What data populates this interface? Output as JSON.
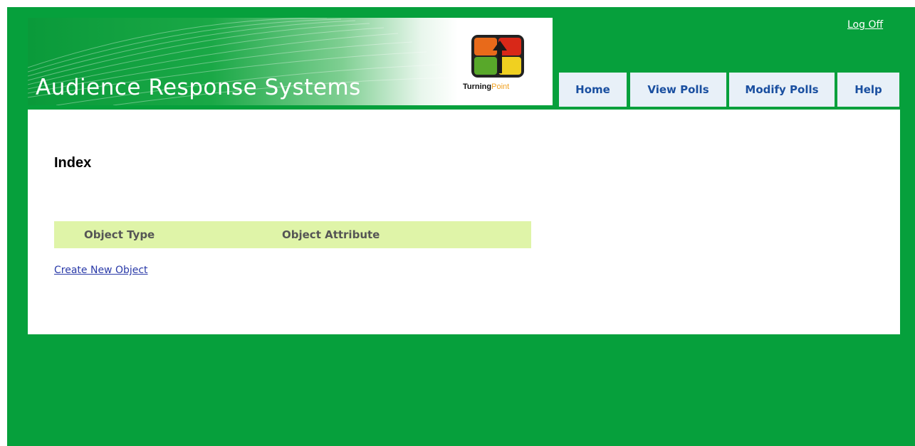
{
  "header": {
    "title": "Audience Response Systems",
    "brand_bold": "Turning",
    "brand_light": "Point",
    "logoff_label": "Log Off"
  },
  "nav": {
    "tabs": [
      {
        "label": "Home"
      },
      {
        "label": "View Polls"
      },
      {
        "label": "Modify Polls"
      },
      {
        "label": "Help"
      }
    ]
  },
  "main": {
    "title": "Index",
    "table": {
      "columns": [
        "Object Type",
        "Object Attribute"
      ]
    },
    "create_link": "Create New Object"
  },
  "colors": {
    "page_background": "#06a03c",
    "tab_background": "#e8f0f8",
    "tab_text": "#1a4fa0",
    "table_header_background": "#dff4a8",
    "link": "#2a3aa8"
  }
}
